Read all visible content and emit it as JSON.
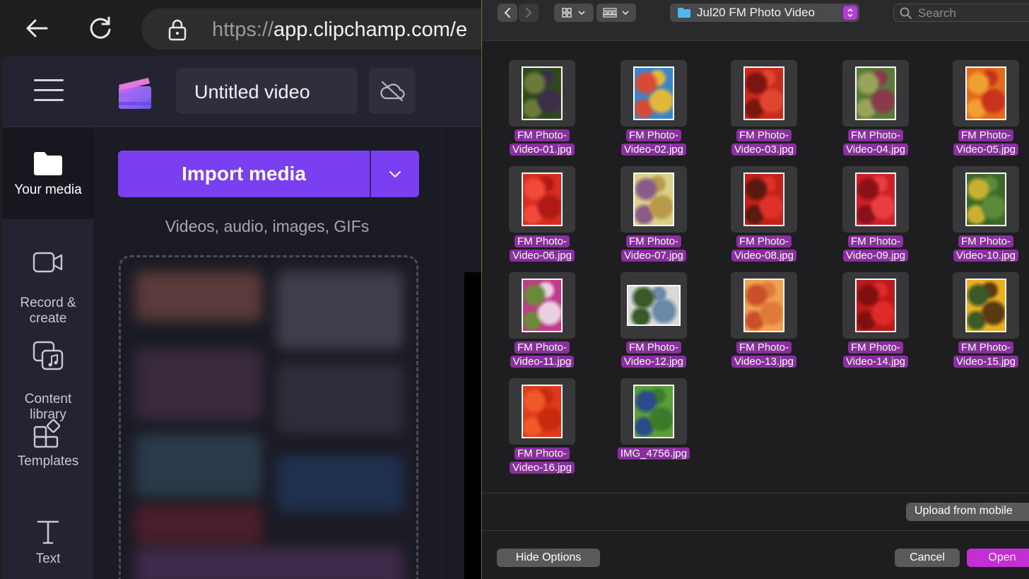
{
  "browser": {
    "url_scheme": "https://",
    "url_host": "app.clipchamp.com/e"
  },
  "app": {
    "project_title": "Untitled video",
    "import_button_label": "Import media",
    "import_hint": "Videos, audio, images, GIFs",
    "nav": [
      {
        "label": "Your media",
        "icon": "folder-icon"
      },
      {
        "label": "Record &\ncreate",
        "icon": "camera-icon"
      },
      {
        "label": "Content\nlibrary",
        "icon": "content-library-icon"
      },
      {
        "label": "Templates",
        "icon": "templates-icon"
      },
      {
        "label": "Text",
        "icon": "text-icon"
      }
    ]
  },
  "dialog": {
    "folder_name": "Jul20 FM Photo Video",
    "search_placeholder": "Search",
    "files": [
      {
        "line1": "FM Photo-",
        "line2": "Video-01.jpg",
        "colors": [
          "#2d4a1c",
          "#3d2f4a",
          "#6b7a3a"
        ]
      },
      {
        "line1": "FM Photo-",
        "line2": "Video-02.jpg",
        "colors": [
          "#3a86c9",
          "#e2b83c",
          "#d94a36"
        ]
      },
      {
        "line1": "FM Photo-",
        "line2": "Video-03.jpg",
        "colors": [
          "#c92a1c",
          "#e0452e",
          "#7a1510"
        ]
      },
      {
        "line1": "FM Photo-",
        "line2": "Video-04.jpg",
        "colors": [
          "#5a7a3a",
          "#8a3a4a",
          "#9aa35a"
        ]
      },
      {
        "line1": "FM Photo-",
        "line2": "Video-05.jpg",
        "colors": [
          "#e26a1c",
          "#c9321c",
          "#f0a030"
        ]
      },
      {
        "line1": "FM Photo-",
        "line2": "Video-06.jpg",
        "colors": [
          "#d92c22",
          "#b01a14",
          "#f04a3a"
        ]
      },
      {
        "line1": "FM Photo-",
        "line2": "Video-07.jpg",
        "colors": [
          "#d9d08a",
          "#b89a4a",
          "#8a5a8a"
        ]
      },
      {
        "line1": "FM Photo-",
        "line2": "Video-08.jpg",
        "colors": [
          "#c4201a",
          "#e0302a",
          "#5a1a10"
        ]
      },
      {
        "line1": "FM Photo-",
        "line2": "Video-09.jpg",
        "colors": [
          "#d0202a",
          "#e84040",
          "#8a101a"
        ]
      },
      {
        "line1": "FM Photo-",
        "line2": "Video-10.jpg",
        "colors": [
          "#3a6a2a",
          "#5a8a3a",
          "#c9b030"
        ]
      },
      {
        "line1": "FM Photo-",
        "line2": "Video-11.jpg",
        "colors": [
          "#c23a8a",
          "#e8d0e0",
          "#6a8a3a"
        ]
      },
      {
        "line1": "FM Photo-",
        "line2": "Video-12.jpg",
        "colors": [
          "#d8d8d8",
          "#6a8aaa",
          "#3a5a2a"
        ]
      },
      {
        "line1": "FM Photo-",
        "line2": "Video-13.jpg",
        "colors": [
          "#f0a050",
          "#e07a3a",
          "#c9502a"
        ]
      },
      {
        "line1": "FM Photo-",
        "line2": "Video-14.jpg",
        "colors": [
          "#c01818",
          "#e02a2a",
          "#801010"
        ]
      },
      {
        "line1": "FM Photo-",
        "line2": "Video-15.jpg",
        "colors": [
          "#e8b020",
          "#5a3a10",
          "#3a5a2a"
        ]
      },
      {
        "line1": "FM Photo-",
        "line2": "Video-16.jpg",
        "colors": [
          "#e03a1a",
          "#c82a10",
          "#f05a2a"
        ]
      },
      {
        "line1": "IMG_4756.jpg",
        "line2": "",
        "colors": [
          "#5aa03a",
          "#3a7a2a",
          "#2a4a8a"
        ]
      }
    ],
    "upload_mobile_label": "Upload from mobile",
    "hide_options_label": "Hide Options",
    "cancel_label": "Cancel",
    "open_label": "Open"
  },
  "colors": {
    "accent_purple": "#7b3ff2",
    "dialog_highlight": "#8a2fa0",
    "open_button": "#c32fd4"
  }
}
